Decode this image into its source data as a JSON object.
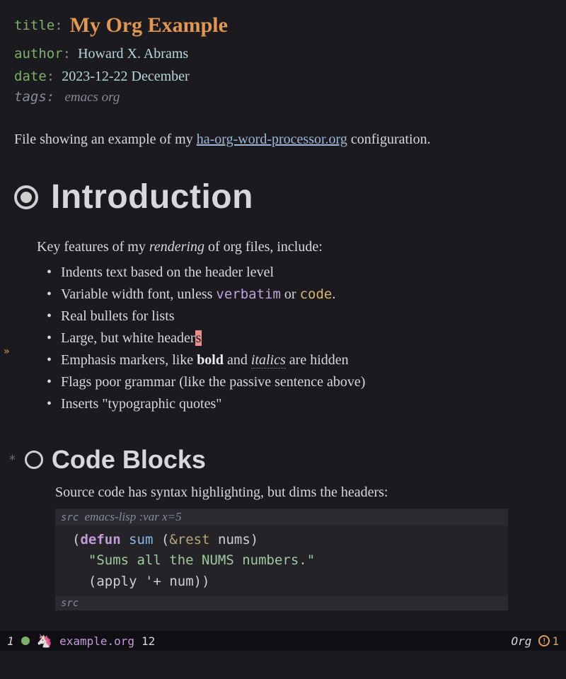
{
  "meta": {
    "title_key": "title",
    "title_value": "My Org Example",
    "author_key": "author",
    "author_value": "Howard X. Abrams",
    "date_key": "date",
    "date_value": "2023-12-22 December",
    "tags_key": "tags:",
    "tags_value": "emacs org"
  },
  "intro": {
    "prefix": "File showing an example of my ",
    "link_text": "ha-org-word-processor.org",
    "suffix": " configuration."
  },
  "h1": {
    "text": "Introduction"
  },
  "body1": {
    "lead_a": "Key features of my ",
    "lead_b": "rendering",
    "lead_c": " of org files, include:",
    "items": [
      "Indents text based on the header level",
      "",
      "Real bullets for lists",
      "",
      "",
      "Flags poor grammar (like the passive sentence above)",
      "Inserts \"typographic quotes\""
    ],
    "item1_a": "Variable width font, unless ",
    "item1_verb": "verbatim",
    "item1_b": " or ",
    "item1_code": "code",
    "item1_c": ".",
    "item3_a": "Large, but white header",
    "item3_cursor": "s",
    "item4_a": "Emphasis markers, like ",
    "item4_bold": "bold",
    "item4_b": " and ",
    "item4_italic": "italics",
    "item4_c": " are hidden"
  },
  "h2": {
    "star": "*",
    "text": "Code Blocks"
  },
  "body2": {
    "para": "Source code has syntax highlighting, but dims the headers:",
    "src_label": "src",
    "src_lang": "emacs-lisp :var x=5",
    "code": {
      "l1_defun": "defun",
      "l1_name": "sum",
      "l1_rest": "&rest",
      "l1_arg": "nums",
      "l2_doc": "\"Sums all the NUMS numbers.\"",
      "l3_apply": "apply",
      "l3_q": "'+",
      "l3_arg": "num"
    },
    "src_end": "src"
  },
  "modeline": {
    "win": "1",
    "file": "example.org",
    "line": "12",
    "mode": "Org",
    "warn": "1",
    "unicorn": "🦄"
  }
}
